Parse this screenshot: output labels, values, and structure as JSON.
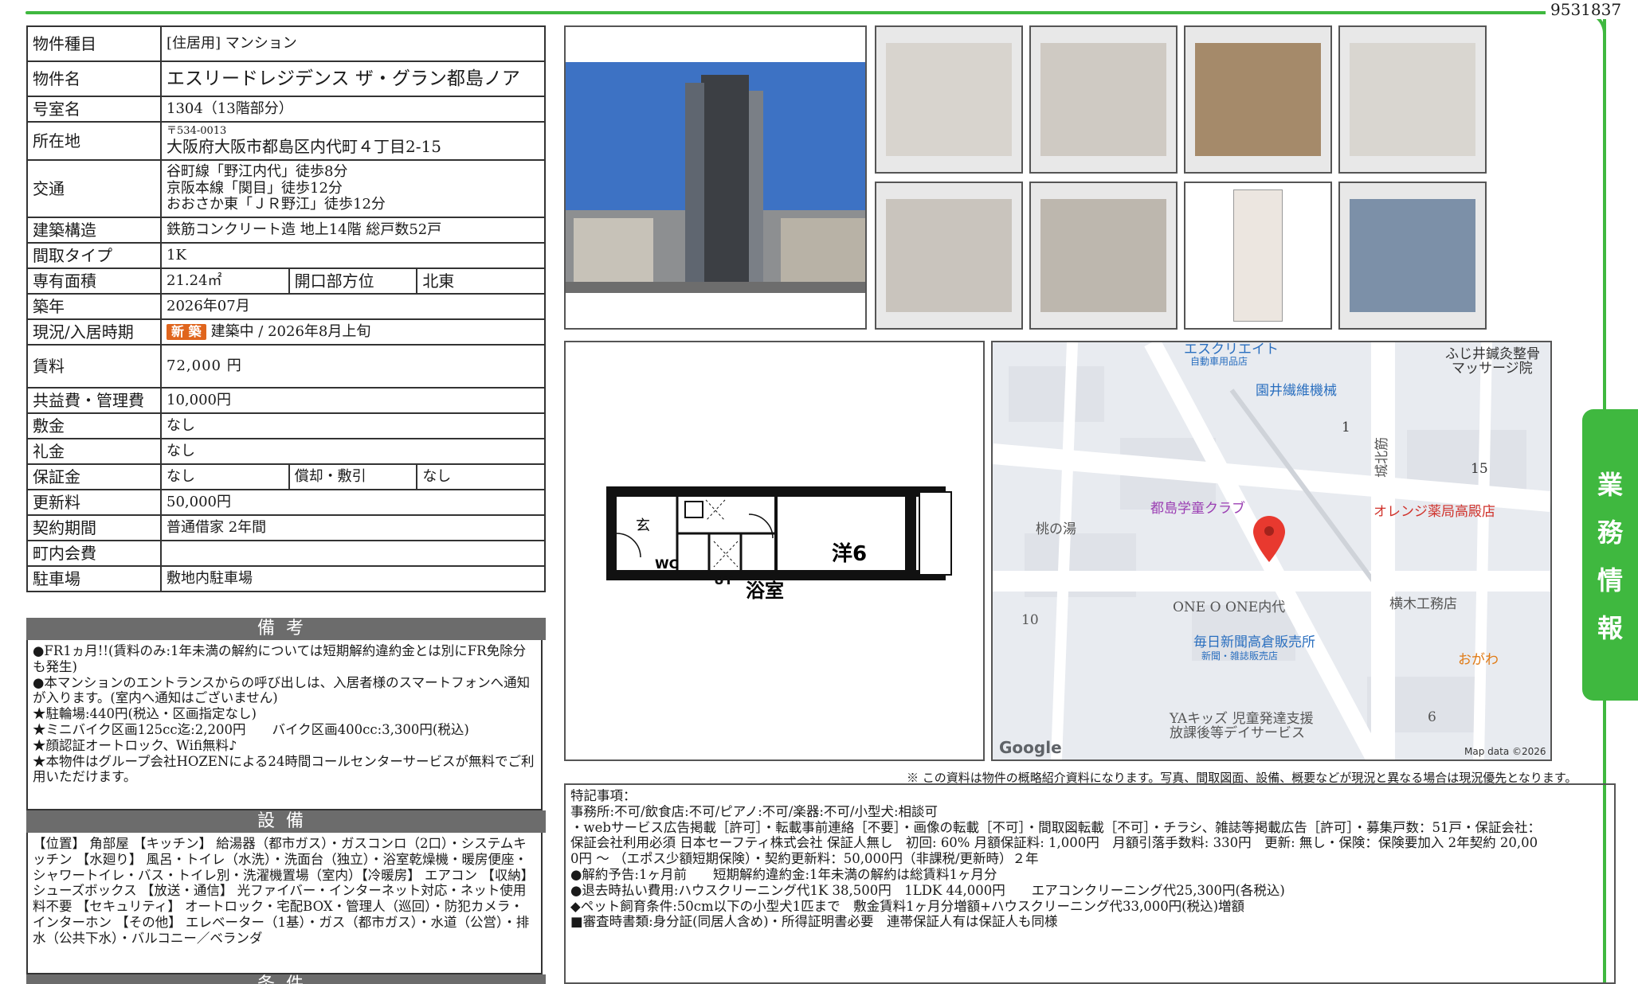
{
  "id_number": "9531837",
  "side_tab": [
    "業",
    "務",
    "情",
    "報"
  ],
  "property": {
    "type": {
      "label": "物件種目",
      "value": "[住居用] マンション"
    },
    "name": {
      "label": "物件名",
      "value": "エスリードレジデンス ザ・グラン都島ノア"
    },
    "room": {
      "label": "号室名",
      "value": "1304（13階部分）"
    },
    "address": {
      "label": "所在地",
      "postal": "〒534-0013",
      "value": "大阪府大阪市都島区内代町４丁目2-15"
    },
    "transport": {
      "label": "交通",
      "lines": [
        "谷町線「野江内代」徒歩8分",
        "京阪本線「関目」徒歩12分",
        "おおさか東「ＪＲ野江」徒歩12分"
      ]
    },
    "structure": {
      "label": "建築構造",
      "value": "鉄筋コンクリート造 地上14階 総戸数52戸"
    },
    "layout": {
      "label": "間取タイプ",
      "value": "1K"
    },
    "area": {
      "label": "専有面積",
      "value": "21.24㎡",
      "dir_label": "開口部方位",
      "dir_value": "北東"
    },
    "built": {
      "label": "築年",
      "value": "2026年07月"
    },
    "status": {
      "label": "現況/入居時期",
      "badge": "新 築",
      "value": "建築中 /  2026年8月上旬"
    },
    "rent": {
      "label": "賃料",
      "value": "72,000 円"
    },
    "fee": {
      "label": "共益費・管理費",
      "value": "10,000円"
    },
    "deposit": {
      "label": "敷金",
      "value": "なし"
    },
    "key_money": {
      "label": "礼金",
      "value": "なし"
    },
    "guarantee": {
      "label": "保証金",
      "value": "なし",
      "amort_label": "償却・敷引",
      "amort_value": "なし"
    },
    "renewal": {
      "label": "更新料",
      "value": "50,000円"
    },
    "contract": {
      "label": "契約期間",
      "value": "普通借家 2年間"
    },
    "community": {
      "label": "町内会費",
      "value": ""
    },
    "parking": {
      "label": "駐車場",
      "value": "敷地内駐車場"
    }
  },
  "remarks": {
    "title": "備考",
    "lines": [
      "●FR1ヵ月!!(賃料のみ:1年未満の解約については短期解約違約金とは別にFR免除分も発生)",
      "●本マンションのエントランスからの呼び出しは、入居者様のスマートフォンへ通知が入ります。(室内へ通知はございません)",
      "★駐輪場:440円(税込・区画指定なし)",
      "★ミニバイク区画125cc迄:2,200円　　バイク区画400cc:3,300円(税込)",
      "★顔認証オートロック、Wifi無料♪",
      "★本物件はグループ会社HOZENによる24時間コールセンターサービスが無料でご利用いただけます。"
    ]
  },
  "facilities": {
    "title": "設備",
    "text": "【位置】 角部屋 【キッチン】 給湯器（都市ガス）・ガスコンロ（2口）・システムキッチン 【水廻り】 風呂・トイレ（水洗）・洗面台（独立）・浴室乾燥機・暖房便座・シャワートイレ・バス・トイレ別・洗濯機置場（室内）【冷暖房】 エアコン 【収納】 シューズボックス 【放送・通信】 光ファイバー・インターネット対応・ネット使用料不要 【セキュリティ】 オートロック・宅配BOX・管理人（巡回）・防犯カメラ・インターホン 【その他】 エレベーター（1基）・ガス（都市ガス）・水道（公営）・排水（公共下水）・バルコニー／ベランダ"
  },
  "conditions": {
    "title": "条件"
  },
  "floor_plan": {
    "room_label": "洋6",
    "bath_label": "浴室",
    "entry_label": "玄",
    "wc_label": "WC",
    "ut_label": "UT"
  },
  "map": {
    "labels": {
      "esucreate": "エスクリエイト",
      "esucreate_sub": "自動車用品店",
      "fujii": "ふじ井鍼灸整骨",
      "fujii_sub": "マッサージ院",
      "enoi": "園井繊維機械",
      "jounou": "城北筋",
      "block1": "1",
      "block15": "15",
      "miyakojima": "都島学童クラブ",
      "orange": "オレンジ薬局高殿店",
      "momo": "桃の湯",
      "one": "ONE O ONE内代",
      "yokogi": "横木工務店",
      "block10": "10",
      "mainichi": "毎日新聞高倉販売所",
      "mainichi_sub": "新聞・雑誌販売店",
      "ogawa": "おがわ",
      "ya": "YAキッズ 児童発達支援",
      "ya_sub": "放課後等デイサービス",
      "block6": "6",
      "google": "Google",
      "mapdata": "Map data ©2026"
    }
  },
  "notice": "※ この資料は物件の概略紹介資料になります。写真、間取図面、設備、概要などが現況と異なる場合は現況優先となります。",
  "special": {
    "lines": [
      "特記事項：",
      "事務所:不可/飲食店:不可/ピアノ:不可/楽器:不可/小型犬:相談可",
      "・webサービス広告掲載［許可］・転載事前連絡［不要］・画像の転載［不可］・間取図転載［不可］・チラシ、雑誌等掲載広告［許可］・募集戸数：51戸・保証会社：",
      "保証会社利用必須 日本セーフティ株式会社 保証人無し　初回: 60%  月額保証料: 1,000円　月額引落手数料: 330円　更新: 無し・保険：保険要加入 2年契約 20,00",
      "0円 ～ （エポス少額短期保険）・契約更新料：50,000円（非課税/更新時）２年",
      "●解約予告:1ヶ月前　　短期解約違約金:1年未満の解約は総賃料1ヶ月分",
      "●退去時払い費用:ハウスクリーニング代1K 38,500円　1LDK 44,000円　　エアコンクリーニング代25,300円(各税込)",
      "◆ペット飼育条件:50cm以下の小型犬1匹まで　敷金賃料1ヶ月分増額+ハウスクリーニング代33,000円(税込)増額",
      "■審査時書類:身分証(同居人含め)・所得証明書必要　連帯保証人有は保証人も同様"
    ]
  },
  "colors": {
    "brand_green": "#3fb83f",
    "badge_orange": "#e0651d",
    "section_gray": "#6c6c6c"
  }
}
